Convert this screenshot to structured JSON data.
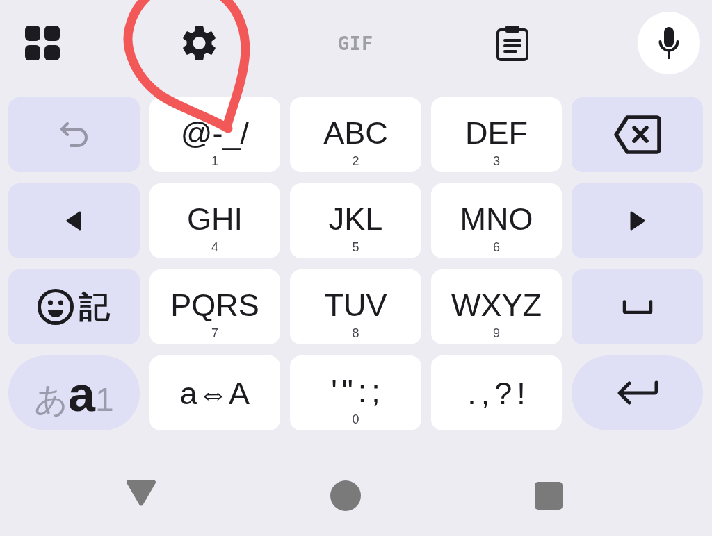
{
  "toolbar": {
    "gif_label": "GIF"
  },
  "keyboard": {
    "rows": [
      [
        {
          "kind": "undo",
          "disabled": true
        },
        {
          "kind": "char",
          "label": "@-_/",
          "digit": "1",
          "disabled": false
        },
        {
          "kind": "char",
          "label": "ABC",
          "digit": "2",
          "disabled": false
        },
        {
          "kind": "char",
          "label": "DEF",
          "digit": "3",
          "disabled": false
        },
        {
          "kind": "backspace",
          "disabled": false
        }
      ],
      [
        {
          "kind": "left",
          "disabled": false
        },
        {
          "kind": "char",
          "label": "GHI",
          "digit": "4",
          "disabled": false
        },
        {
          "kind": "char",
          "label": "JKL",
          "digit": "5",
          "disabled": false
        },
        {
          "kind": "char",
          "label": "MNO",
          "digit": "6",
          "disabled": false
        },
        {
          "kind": "right",
          "disabled": false
        }
      ],
      [
        {
          "kind": "symbols",
          "label": "記",
          "disabled": false
        },
        {
          "kind": "char",
          "label": "PQRS",
          "digit": "7",
          "disabled": false
        },
        {
          "kind": "char",
          "label": "TUV",
          "digit": "8",
          "disabled": false
        },
        {
          "kind": "char",
          "label": "WXYZ",
          "digit": "9",
          "disabled": false
        },
        {
          "kind": "space",
          "disabled": false
        }
      ],
      [
        {
          "kind": "mode",
          "disabled": false,
          "modes": [
            {
              "label": "あ",
              "selected": false
            },
            {
              "label": "a",
              "selected": true
            },
            {
              "label": "1",
              "selected": false
            }
          ]
        },
        {
          "kind": "char",
          "label": "a⇔A",
          "disabled": false
        },
        {
          "kind": "punctuation",
          "label": "'\":;",
          "digit": "0",
          "disabled": false
        },
        {
          "kind": "punctuation",
          "label": ".,?!",
          "disabled": false
        },
        {
          "kind": "enter",
          "disabled": false
        }
      ]
    ]
  }
}
